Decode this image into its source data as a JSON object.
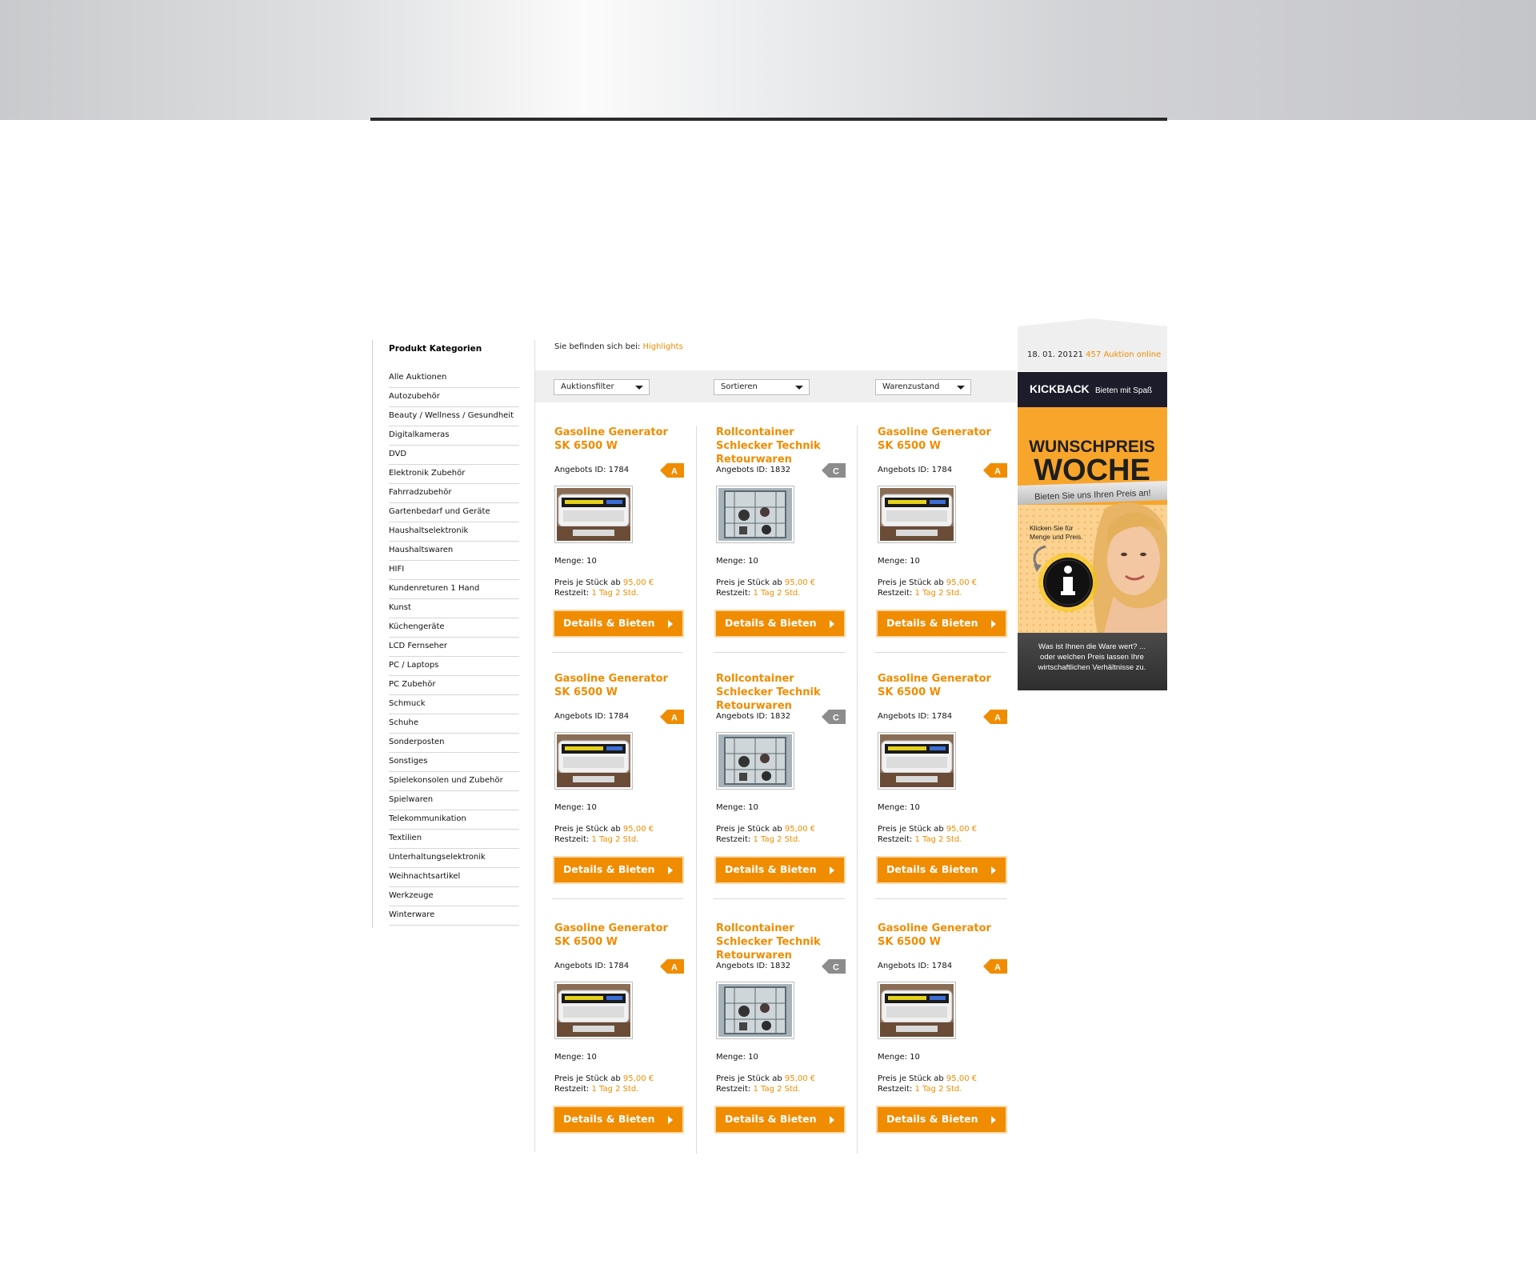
{
  "sidebar": {
    "title": "Produkt Kategorien",
    "categories": [
      "Alle Auktionen",
      "Autozubehör",
      "Beauty / Wellness / Gesundheit",
      "Digitalkameras",
      "DVD",
      "Elektronik Zubehör",
      "Fahrradzubehör",
      "Gartenbedarf und Geräte",
      "Haushaltselektronik",
      "Haushaltswaren",
      "HIFI",
      "Kundenreturen 1 Hand",
      "Kunst",
      "Küchengeräte",
      "LCD Fernseher",
      "PC / Laptops",
      "PC Zubehör",
      "Schmuck",
      "Schuhe",
      "Sonderposten",
      "Sonstiges",
      "Spielekonsolen und Zubehör",
      "Spielwaren",
      "Telekommunikation",
      "Textilien",
      "Unterhaltungselektronik",
      "Weihnachtsartikel",
      "Werkzeuge",
      "Winterware"
    ]
  },
  "breadcrumb": {
    "prefix": "Sie befinden sich bei:",
    "current": "Highlights"
  },
  "filters": {
    "filter": "Auktionsfilter",
    "sort": "Sortieren",
    "condition": "Warenzustand"
  },
  "products": [
    {
      "title": "Gasoline Generator SK 6500 W",
      "id_label": "Angebots ID: 1784",
      "grade": "A",
      "grade_color": "#f08c00",
      "qty": "Menge: 10",
      "price_label": "Preis je Stück ab",
      "price": "95,00 €",
      "time_label": "Restzeit:",
      "time": "1 Tag 2 Std.",
      "button": "Details & Bieten",
      "image": "generator"
    },
    {
      "title": "Rollcontainer Schlecker Technik Retourwaren",
      "id_label": "Angebots ID: 1832",
      "grade": "C",
      "grade_color": "#8c8c8c",
      "qty": "Menge: 10",
      "price_label": "Preis je Stück ab",
      "price": "95,00 €",
      "time_label": "Restzeit:",
      "time": "1 Tag 2 Std.",
      "button": "Details & Bieten",
      "image": "rollcontainer"
    },
    {
      "title": "Gasoline Generator SK 6500 W",
      "id_label": "Angebots ID: 1784",
      "grade": "A",
      "grade_color": "#f08c00",
      "qty": "Menge: 10",
      "price_label": "Preis je Stück ab",
      "price": "95,00 €",
      "time_label": "Restzeit:",
      "time": "1 Tag 2 Std.",
      "button": "Details & Bieten",
      "image": "generator"
    },
    {
      "title": "Gasoline Generator SK 6500 W",
      "id_label": "Angebots ID: 1784",
      "grade": "A",
      "grade_color": "#f08c00",
      "qty": "Menge: 10",
      "price_label": "Preis je Stück ab",
      "price": "95,00 €",
      "time_label": "Restzeit:",
      "time": "1 Tag 2 Std.",
      "button": "Details & Bieten",
      "image": "generator"
    },
    {
      "title": "Rollcontainer Schlecker Technik Retourwaren",
      "id_label": "Angebots ID: 1832",
      "grade": "C",
      "grade_color": "#8c8c8c",
      "qty": "Menge: 10",
      "price_label": "Preis je Stück ab",
      "price": "95,00 €",
      "time_label": "Restzeit:",
      "time": "1 Tag 2 Std.",
      "button": "Details & Bieten",
      "image": "rollcontainer"
    },
    {
      "title": "Gasoline Generator SK 6500 W",
      "id_label": "Angebots ID: 1784",
      "grade": "A",
      "grade_color": "#f08c00",
      "qty": "Menge: 10",
      "price_label": "Preis je Stück ab",
      "price": "95,00 €",
      "time_label": "Restzeit:",
      "time": "1 Tag 2 Std.",
      "button": "Details & Bieten",
      "image": "generator"
    },
    {
      "title": "Gasoline Generator SK 6500 W",
      "id_label": "Angebots ID: 1784",
      "grade": "A",
      "grade_color": "#f08c00",
      "qty": "Menge: 10",
      "price_label": "Preis je Stück ab",
      "price": "95,00 €",
      "time_label": "Restzeit:",
      "time": "1 Tag 2 Std.",
      "button": "Details & Bieten",
      "image": "generator"
    },
    {
      "title": "Rollcontainer Schlecker Technik Retourwaren",
      "id_label": "Angebots ID: 1832",
      "grade": "C",
      "grade_color": "#8c8c8c",
      "qty": "Menge: 10",
      "price_label": "Preis je Stück ab",
      "price": "95,00 €",
      "time_label": "Restzeit:",
      "time": "1 Tag 2 Std.",
      "button": "Details & Bieten",
      "image": "rollcontainer"
    },
    {
      "title": "Gasoline Generator SK 6500 W",
      "id_label": "Angebots ID: 1784",
      "grade": "A",
      "grade_color": "#f08c00",
      "qty": "Menge: 10",
      "price_label": "Preis je Stück ab",
      "price": "95,00 €",
      "time_label": "Restzeit:",
      "time": "1 Tag 2 Std.",
      "button": "Details & Bieten",
      "image": "generator"
    }
  ],
  "right_panel": {
    "date": "18. 01. 20121",
    "online": "457 Auktion online",
    "banner": {
      "brand": "KICKBACK",
      "tagline": "Bieten mit Spaß",
      "headline1": "WUNSCHPREIS",
      "headline2": "WOCHE",
      "subline": "Bieten Sie uns Ihren Preis an!",
      "hint1": "Klicken Sie für",
      "hint2": "Menge und Preis.",
      "info_icon": "info-icon",
      "footer1": "Was ist Ihnen die Ware wert? ...",
      "footer2": "oder welchen Preis lassen Ihre",
      "footer3": "wirtschaftlichen Verhältnisse zu."
    }
  },
  "colors": {
    "accent": "#f08c00",
    "grade_a": "#f08c00",
    "grade_c": "#8c8c8c"
  }
}
